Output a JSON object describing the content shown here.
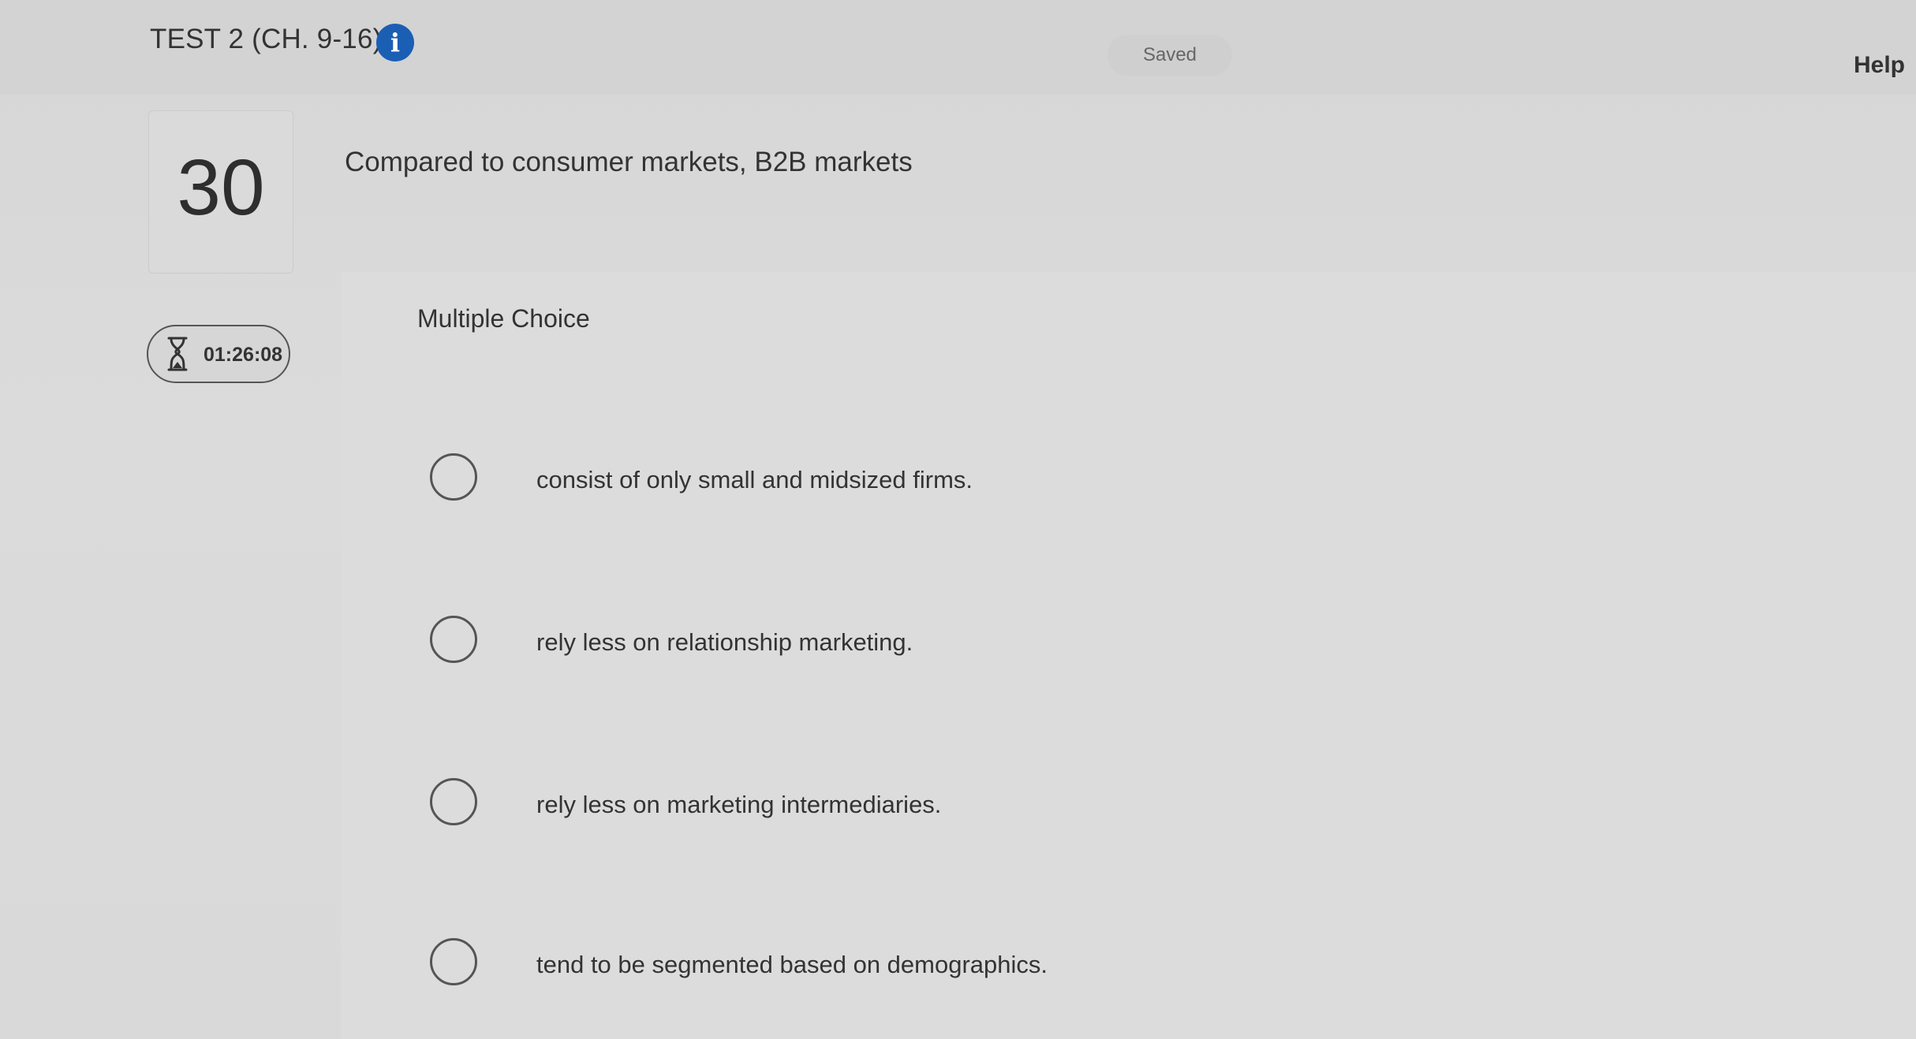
{
  "header": {
    "title": "TEST 2 (CH. 9-16)",
    "info_icon": "i",
    "saved_label": "Saved",
    "help_label": "Help"
  },
  "question": {
    "number": "30",
    "prompt": "Compared to consumer markets, B2B markets",
    "type_label": "Multiple Choice",
    "options": [
      "consist of only small and midsized firms.",
      "rely less on relationship marketing.",
      "rely less on marketing intermediaries.",
      "tend to be segmented based on demographics."
    ]
  },
  "timer": {
    "icon": "hourglass-icon",
    "value": "01:26:08"
  },
  "colors": {
    "info_icon_blue": "#1a5fb4",
    "text": "#333333",
    "background": "#d8d8d8"
  }
}
